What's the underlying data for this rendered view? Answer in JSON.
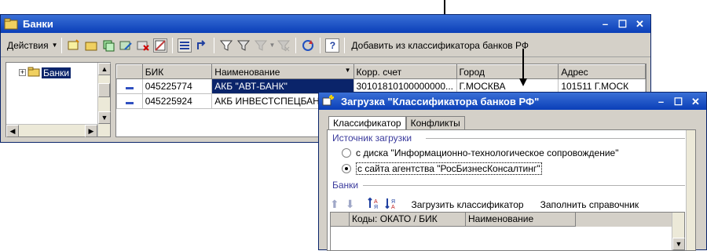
{
  "main_window": {
    "title": "Банки",
    "toolbar": {
      "actions_label": "Действия",
      "add_from_classifier_label": "Добавить из классификатора банков РФ"
    },
    "tree": {
      "root_label": "Банки"
    },
    "grid": {
      "columns": [
        "БИК",
        "Наименование",
        "Корр. счет",
        "Город",
        "Адрес"
      ],
      "rows": [
        {
          "bik": "045225774",
          "name": "АКБ \"АВТ-БАНК\"",
          "corr": "30101810100000000...",
          "city": "Г.МОСКВА",
          "addr": "101511 Г.МОСК"
        },
        {
          "bik": "045225924",
          "name": "АКБ ИНВЕСТСПЕЦБАН",
          "corr": "",
          "city": "",
          "addr": ""
        }
      ]
    }
  },
  "dialog": {
    "title": "Загрузка \"Классификатора банков РФ\"",
    "tabs": [
      "Классификатор",
      "Конфликты"
    ],
    "source_group_title": "Источник загрузки",
    "source_options": [
      "с диска \"Информационно-технологическое сопровождение\"",
      "с сайта агентства \"РосБизнесКонсалтинг\""
    ],
    "banks_group_title": "Банки",
    "load_button": "Загрузить классификатор",
    "fill_button": "Заполнить справочник",
    "grid_columns": [
      "Коды: ОКАТО / БИК",
      "Наименование"
    ]
  },
  "colors": {
    "title_blue": "#0a3fb8",
    "selection": "#0a246a",
    "group_title": "#3a3a9c"
  }
}
